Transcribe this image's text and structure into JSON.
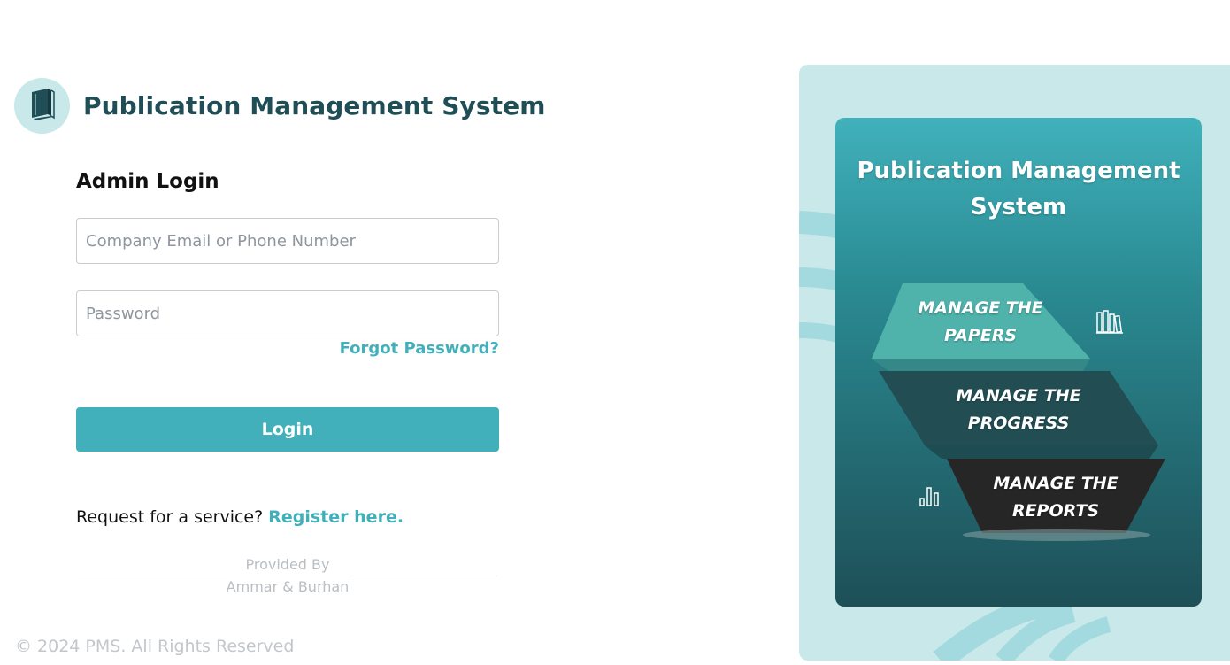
{
  "brand": {
    "title": "Publication Management System",
    "logo_icon": "book-icon"
  },
  "login": {
    "heading": "Admin Login",
    "email_placeholder": "Company Email or Phone Number",
    "email_value": "",
    "password_placeholder": "Password",
    "password_value": "",
    "forgot_label": "Forgot Password?",
    "submit_label": "Login"
  },
  "register": {
    "prompt": "Request for a service?",
    "link_label": "Register here."
  },
  "credits": {
    "provided_by": "Provided By",
    "authors": "Ammar & Burhan"
  },
  "footer": {
    "copyright": "© 2024 PMS. All Rights Reserved"
  },
  "promo": {
    "title_line1": "Publication Management",
    "title_line2": "System",
    "tiers": [
      {
        "line1": "MANAGE THE",
        "line2": "PAPERS",
        "icon": "books-icon"
      },
      {
        "line1": "MANAGE THE",
        "line2": "PROGRESS"
      },
      {
        "line1": "MANAGE THE",
        "line2": "REPORTS",
        "icon": "bar-chart-icon"
      }
    ]
  },
  "colors": {
    "accent": "#42b0ba",
    "brand_text": "#1f4e56",
    "panel_bg": "#c9e8ea",
    "tier1": "#4fb3ac",
    "tier2": "#224e53",
    "tier3": "#262626"
  }
}
